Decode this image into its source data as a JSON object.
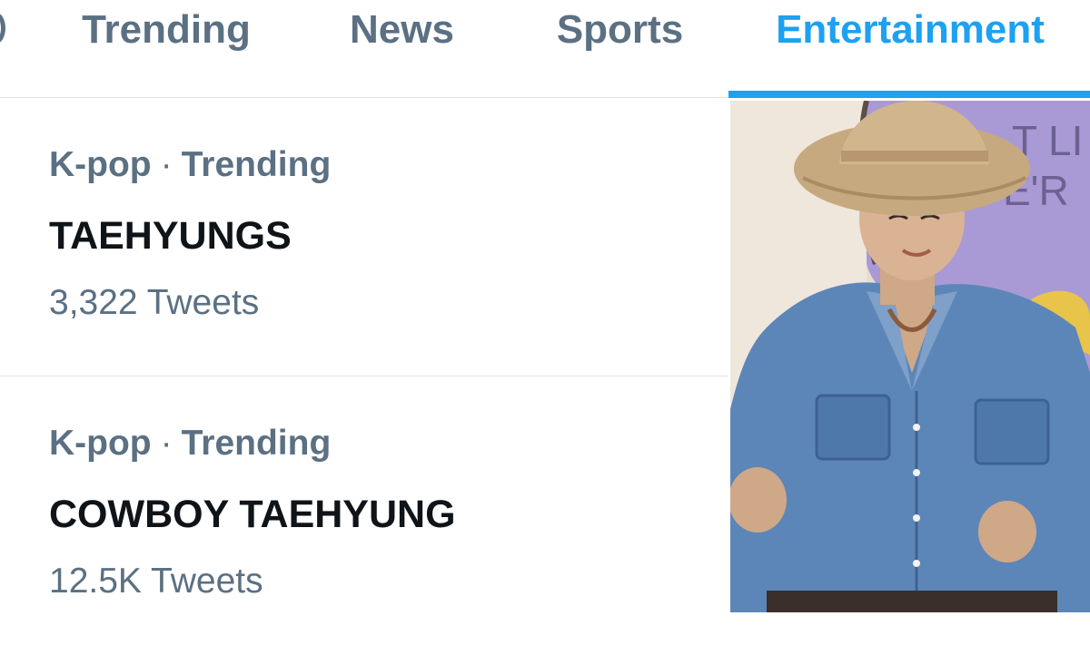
{
  "tabs": [
    {
      "label": "Trending",
      "active": false
    },
    {
      "label": "News",
      "active": false
    },
    {
      "label": "Sports",
      "active": false
    },
    {
      "label": "Entertainment",
      "active": true
    }
  ],
  "colors": {
    "accent": "#1da1f2",
    "secondary_text": "#5b7083",
    "primary_text": "#0f1419",
    "divider": "#dfe3e7"
  },
  "trends": [
    {
      "context": "K-pop",
      "separator": "·",
      "status": "Trending",
      "topic": "TAEHYUNGS",
      "count": "3,322 Tweets"
    },
    {
      "context": "K-pop",
      "separator": "·",
      "status": "Trending",
      "topic": "COWBOY TAEHYUNG",
      "count": "12.5K Tweets"
    }
  ],
  "media": {
    "subject": "person-in-cowboy-hat-and-denim-shirt"
  }
}
